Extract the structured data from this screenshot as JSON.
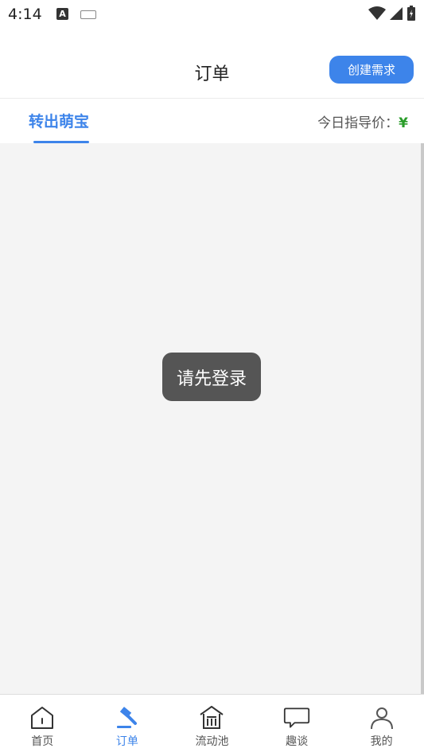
{
  "status": {
    "time": "4:14",
    "app_badge": "A"
  },
  "header": {
    "title": "订单",
    "create_button": "创建需求"
  },
  "tabs": {
    "active_label": "转出萌宝",
    "price_label": "今日指导价：",
    "price_symbol": "¥"
  },
  "toast": {
    "message": "请先登录"
  },
  "nav": {
    "items": [
      {
        "label": "首页",
        "icon": "home-icon",
        "active": false
      },
      {
        "label": "订单",
        "icon": "gavel-icon",
        "active": true
      },
      {
        "label": "流动池",
        "icon": "bank-icon",
        "active": false
      },
      {
        "label": "趣谈",
        "icon": "chat-bubble-icon",
        "active": false
      },
      {
        "label": "我的",
        "icon": "user-icon",
        "active": false
      }
    ]
  },
  "colors": {
    "accent": "#3d84ea",
    "price_symbol": "#2a9d2a",
    "toast_bg": "#555555"
  }
}
